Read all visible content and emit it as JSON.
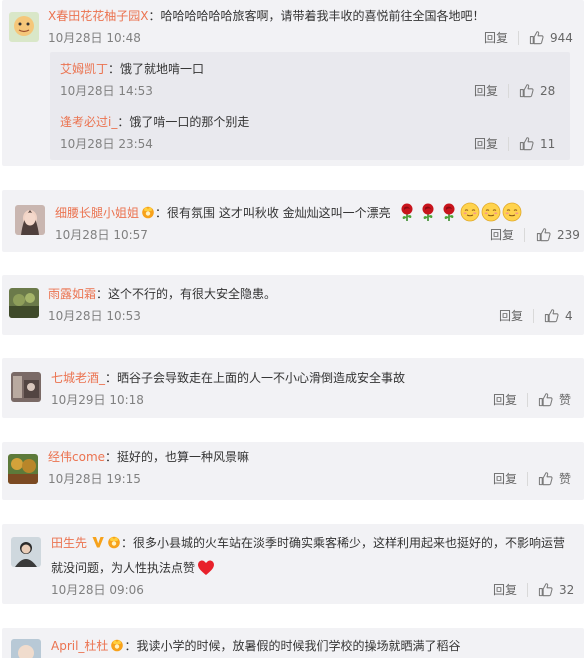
{
  "comments": [
    {
      "user": "X春田花花柚子园X",
      "text": "：哈哈哈哈哈哈旅客啊，请带着我丰收的喜悦前往全国各地吧！",
      "time": "10月28日 10:48",
      "reply": "回复",
      "likes": "944",
      "replies": [
        {
          "user": "艾姆凯丁",
          "text": "：饿了就地啃一口",
          "time": "10月28日 14:53",
          "reply": "回复",
          "likes": "28"
        },
        {
          "user": "逢考必过i_",
          "text": "：饿了啃一口的那个别走",
          "time": "10月28日 23:54",
          "reply": "回复",
          "likes": "11"
        }
      ]
    },
    {
      "user": "细腰长腿小姐姐",
      "text": "：很有氛围 这才叫秋收 金灿灿这叫一个漂亮",
      "time": "10月28日 10:57",
      "reply": "回复",
      "likes": "239"
    },
    {
      "user": "雨露如霜",
      "text": "：这个不行的，有很大安全隐患。",
      "time": "10月28日 10:53",
      "reply": "回复",
      "likes": "4"
    },
    {
      "user": "七城老酒_",
      "text": "：晒谷子会导致走在上面的人一不小心滑倒造成安全事故",
      "time": "10月29日 10:18",
      "reply": "回复",
      "likes": "赞"
    },
    {
      "user": "经伟come",
      "text": "：挺好的，也算一种风景嘛",
      "time": "10月28日 19:15",
      "reply": "回复",
      "likes": "赞"
    },
    {
      "user": "田生先",
      "text": "：很多小县城的火车站在淡季时确实乘客稀少，这样利用起来也挺好的，不影响运营",
      "text2": "就没问题，为人性执法点赞",
      "time": "10月28日 09:06",
      "reply": "回复",
      "likes": "32"
    },
    {
      "user": "April_杜杜",
      "text": "：我读小学的时候，放暑假的时候我们学校的操场就晒满了稻谷"
    }
  ],
  "colors": {
    "name": "#eb7350",
    "card_bg": "#f2f2f5",
    "sub_bg": "#e9e9ee",
    "meta": "#808080"
  },
  "icons": {
    "like": "thumbs-up-icon",
    "rose": "rose-icon",
    "smile": "shy-smile-icon",
    "heart": "heart-icon",
    "badge": "member-badge-icon",
    "verified": "verified-v-icon"
  }
}
